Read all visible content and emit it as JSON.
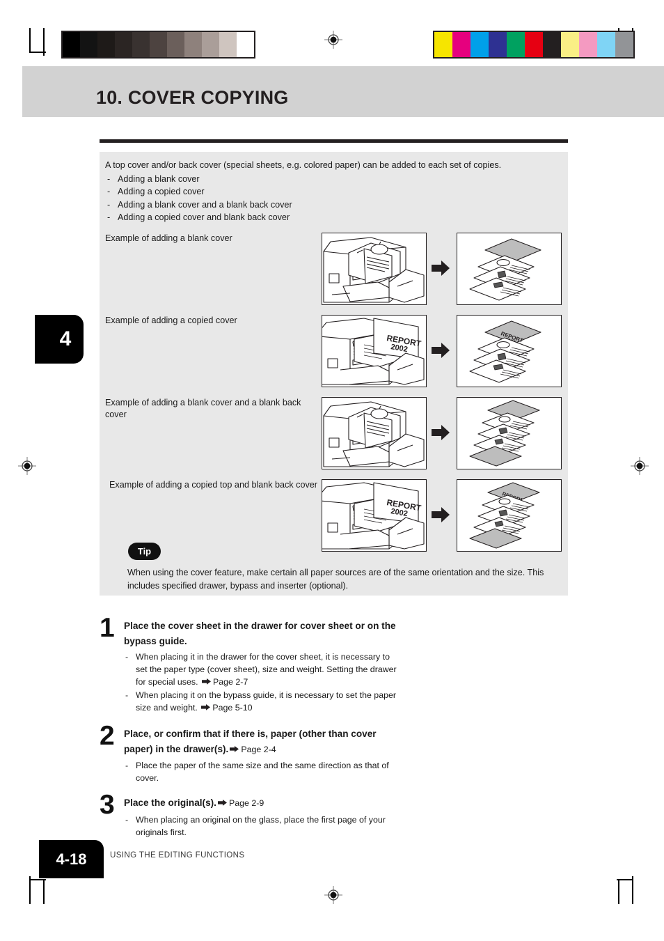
{
  "header": {
    "title": "10. COVER COPYING"
  },
  "chapter": {
    "tab_number": "4"
  },
  "intro": {
    "lead": "A top cover and/or back cover (special sheets, e.g. colored paper) can be added to each set of copies.",
    "dash": "-",
    "bullets": [
      "Adding a blank cover",
      "Adding a copied cover",
      "Adding a blank cover and a blank back cover",
      "Adding a copied cover and blank back cover"
    ]
  },
  "examples": [
    {
      "label": "Example of adding a blank cover",
      "before_icon": "copier-with-originals-illustration",
      "arrow_icon": "right-arrow-icon",
      "after_icon": "stack-blank-top-cover-illustration",
      "cover_text": ""
    },
    {
      "label": "Example of adding a copied cover",
      "before_icon": "copier-with-report-original-illustration",
      "arrow_icon": "right-arrow-icon",
      "after_icon": "stack-copied-top-cover-illustration",
      "cover_text": "REPORT 2002"
    },
    {
      "label": "Example of adding a blank cover and a blank back cover",
      "before_icon": "copier-with-originals-illustration",
      "arrow_icon": "right-arrow-icon",
      "after_icon": "stack-blank-top-and-back-cover-illustration",
      "cover_text": ""
    },
    {
      "label": "Example of adding a copied top and blank back cover",
      "before_icon": "copier-with-report-original-illustration",
      "arrow_icon": "right-arrow-icon",
      "after_icon": "stack-copied-top-blank-back-cover-illustration",
      "cover_text": "REPORT 2002"
    }
  ],
  "tip": {
    "badge": "Tip",
    "text": "When using the cover feature, make certain all paper sources are of the same orientation and the size. This includes specified drawer, bypass and inserter (optional)."
  },
  "steps": [
    {
      "number": "1",
      "heading": "Place the cover sheet in the drawer for cover sheet or on the bypass guide.",
      "page_ref": "",
      "dash": "-",
      "bullets": [
        {
          "text": "When placing it in the drawer for the cover sheet, it is necessary to set the paper type (cover sheet), size and weight. Setting the drawer for special uses.",
          "page_ref": "Page 2-7"
        },
        {
          "text": "When placing it on the bypass guide, it is necessary to set the paper size and weight.",
          "page_ref": "Page 5-10"
        }
      ]
    },
    {
      "number": "2",
      "heading": "Place, or confirm that if there is, paper (other than cover paper) in the drawer(s).",
      "page_ref": "Page 2-4",
      "dash": "-",
      "bullets": [
        {
          "text": "Place the paper of the same size and the same direction as that of cover.",
          "page_ref": ""
        }
      ]
    },
    {
      "number": "3",
      "heading": "Place the original(s).",
      "page_ref": "Page 2-9",
      "dash": "-",
      "bullets": [
        {
          "text": "When placing an original on the glass, place the first page of your originals first.",
          "page_ref": ""
        }
      ]
    }
  ],
  "footer": {
    "page_number": "4-18",
    "section": "USING THE EDITING FUNCTIONS"
  },
  "print_marks": {
    "grayscale_bar": [
      "#000000",
      "#131313",
      "#1e1a18",
      "#2b2523",
      "#393230",
      "#4d4340",
      "#6b5f5b",
      "#8e817c",
      "#aa9e99",
      "#cfc5bf",
      "#ffffff"
    ],
    "color_bar": [
      "#f6e500",
      "#e6007e",
      "#00a0e9",
      "#2e3192",
      "#00a160",
      "#e60012",
      "#231f20",
      "#faef85",
      "#f49ac1",
      "#7fd4f5",
      "#929497"
    ]
  }
}
